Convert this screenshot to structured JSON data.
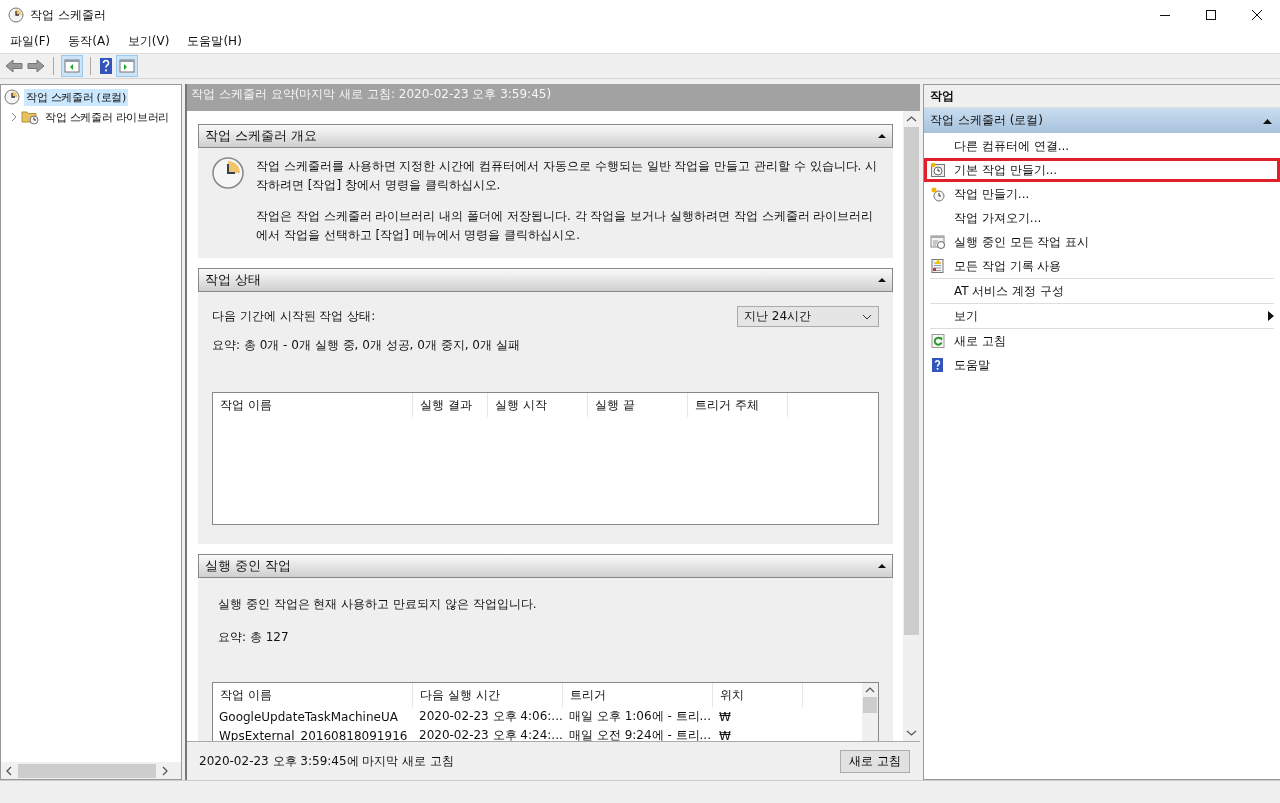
{
  "window": {
    "title": "작업 스케줄러"
  },
  "menu": [
    {
      "label": "파일(F)"
    },
    {
      "label": "동작(A)"
    },
    {
      "label": "보기(V)"
    },
    {
      "label": "도움말(H)"
    }
  ],
  "tree": [
    {
      "label": "작업 스케줄러 (로컬)",
      "selected": true,
      "children": [
        {
          "label": "작업 스케줄러 라이브러리",
          "selected": false,
          "expanded": false
        }
      ]
    }
  ],
  "center": {
    "header": "작업 스케줄러 요약(마지막 새로 고침: 2020-02-23 오후 3:59:45)",
    "sections": [
      {
        "kind": "overview",
        "title": "작업 스케줄러 개요",
        "expanded": true,
        "paragraphs": [
          "작업 스케줄러를 사용하면 지정한 시간에 컴퓨터에서 자동으로 수행되는 일반 작업을 만들고 관리할 수 있습니다. 시작하려면 [작업] 창에서 명령을 클릭하십시오.",
          "작업은 작업 스케줄러 라이브러리 내의 폴더에 저장됩니다. 각 작업을 보거나 실행하려면 작업 스케줄러 라이브러리에서 작업을 선택하고 [작업] 메뉴에서 명령을 클릭하십시오."
        ]
      },
      {
        "kind": "status",
        "title": "작업 상태",
        "expanded": true,
        "period_label": "다음 기간에 시작된 작업 상태:",
        "period": "지난 24시간",
        "summary": "요약: 총 0개 - 0개 실행 중, 0개 성공, 0개 중지, 0개 실패",
        "columns": [
          "작업 이름",
          "실행 결과",
          "실행 시작",
          "실행 끝",
          "트리거 주체"
        ]
      },
      {
        "kind": "running",
        "title": "실행 중인 작업",
        "expanded": true,
        "description": "실행 중인 작업은 현재 사용하고 만료되지 않은 작업입니다.",
        "summary": "요약: 총 127",
        "columns": [
          "작업 이름",
          "다음 실행 시간",
          "트리거",
          "위치"
        ],
        "rows": [
          [
            "GoogleUpdateTaskMachineUA",
            "2020-02-23 오후 4:06:...",
            "매일 오후 1:06에 - 트리...",
            "₩"
          ],
          [
            "WpsExternal_20160818091916",
            "2020-02-23 오후 4:24:...",
            "매일 오전 9:24에 - 트리...",
            "₩"
          ]
        ]
      }
    ],
    "footer": {
      "text": "2020-02-23 오후 3:59:45에 마지막 새로 고침",
      "button": "새로 고침"
    }
  },
  "actions": {
    "title": "작업",
    "group": "작업 스케줄러 (로컬)",
    "expanded": true,
    "groups": [
      [
        {
          "label": "다른 컴퓨터에 연결...",
          "kind": "plain",
          "highlighted": false
        },
        {
          "label": "기본 작업 만들기...",
          "kind": "basic-task",
          "highlighted": true
        },
        {
          "label": "작업 만들기...",
          "kind": "task",
          "highlighted": false
        },
        {
          "label": "작업 가져오기...",
          "kind": "plain",
          "highlighted": false
        },
        {
          "label": "실행 중인 모든 작업 표시",
          "kind": "running",
          "highlighted": false
        },
        {
          "label": "모든 작업 기록 사용",
          "kind": "history",
          "highlighted": false
        }
      ],
      [
        {
          "label": "AT 서비스 계정 구성",
          "kind": "plain",
          "highlighted": false
        }
      ],
      [
        {
          "label": "보기",
          "kind": "submenu",
          "highlighted": false
        }
      ],
      [
        {
          "label": "새로 고침",
          "kind": "refresh",
          "highlighted": false
        },
        {
          "label": "도움말",
          "kind": "help",
          "highlighted": false
        }
      ]
    ]
  }
}
